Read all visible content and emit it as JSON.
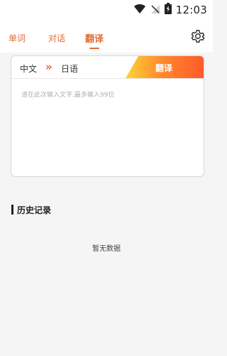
{
  "status_bar": {
    "time": "12:03",
    "icons": [
      "wifi-icon",
      "no-signal-icon",
      "battery-icon"
    ]
  },
  "nav": {
    "tabs": [
      {
        "label": "单词",
        "active": false
      },
      {
        "label": "对话",
        "active": false
      },
      {
        "label": "翻译",
        "active": true
      }
    ],
    "settings_icon": "gear-icon",
    "accent": "#e46b33"
  },
  "translate_panel": {
    "source_language": "中文",
    "swap_symbol": "»",
    "target_language": "日语",
    "button_label": "翻译",
    "input_placeholder": "请在此次输入文字,最多输入99位",
    "gradient": [
      "#ffd33a",
      "#ff8a2b",
      "#ff5a2a"
    ]
  },
  "history": {
    "title": "历史记录",
    "empty_text": "暂无数据"
  }
}
